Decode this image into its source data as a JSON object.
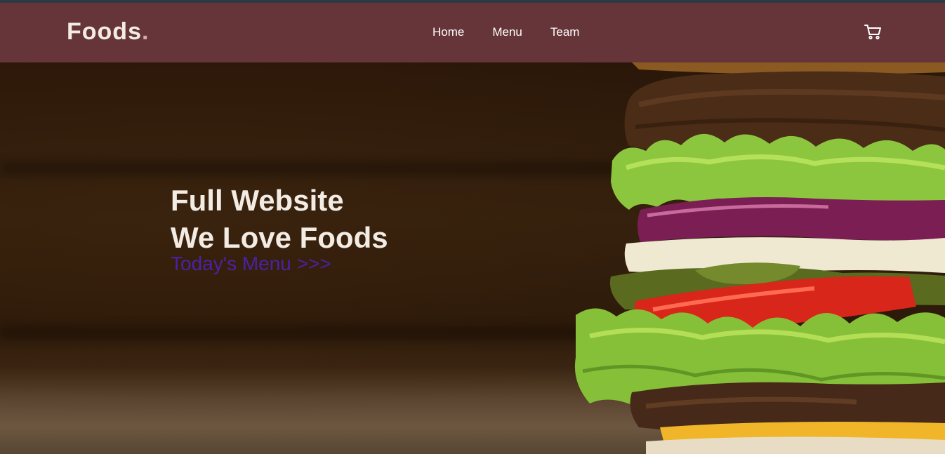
{
  "header": {
    "logo_text": "Foods",
    "logo_dot": ".",
    "nav": [
      "Home",
      "Menu",
      "Team"
    ],
    "cart_icon": "shopping-cart-icon"
  },
  "hero": {
    "line1": "Full Website",
    "line2": "We Love Foods",
    "link": "Today's Menu >>>"
  },
  "colors": {
    "navbar_bg": "#66353a",
    "logo_text": "#f3ece4",
    "logo_dot": "#e0a2ae",
    "hero_text": "#f3ece4",
    "hero_link": "#4b21a6"
  }
}
